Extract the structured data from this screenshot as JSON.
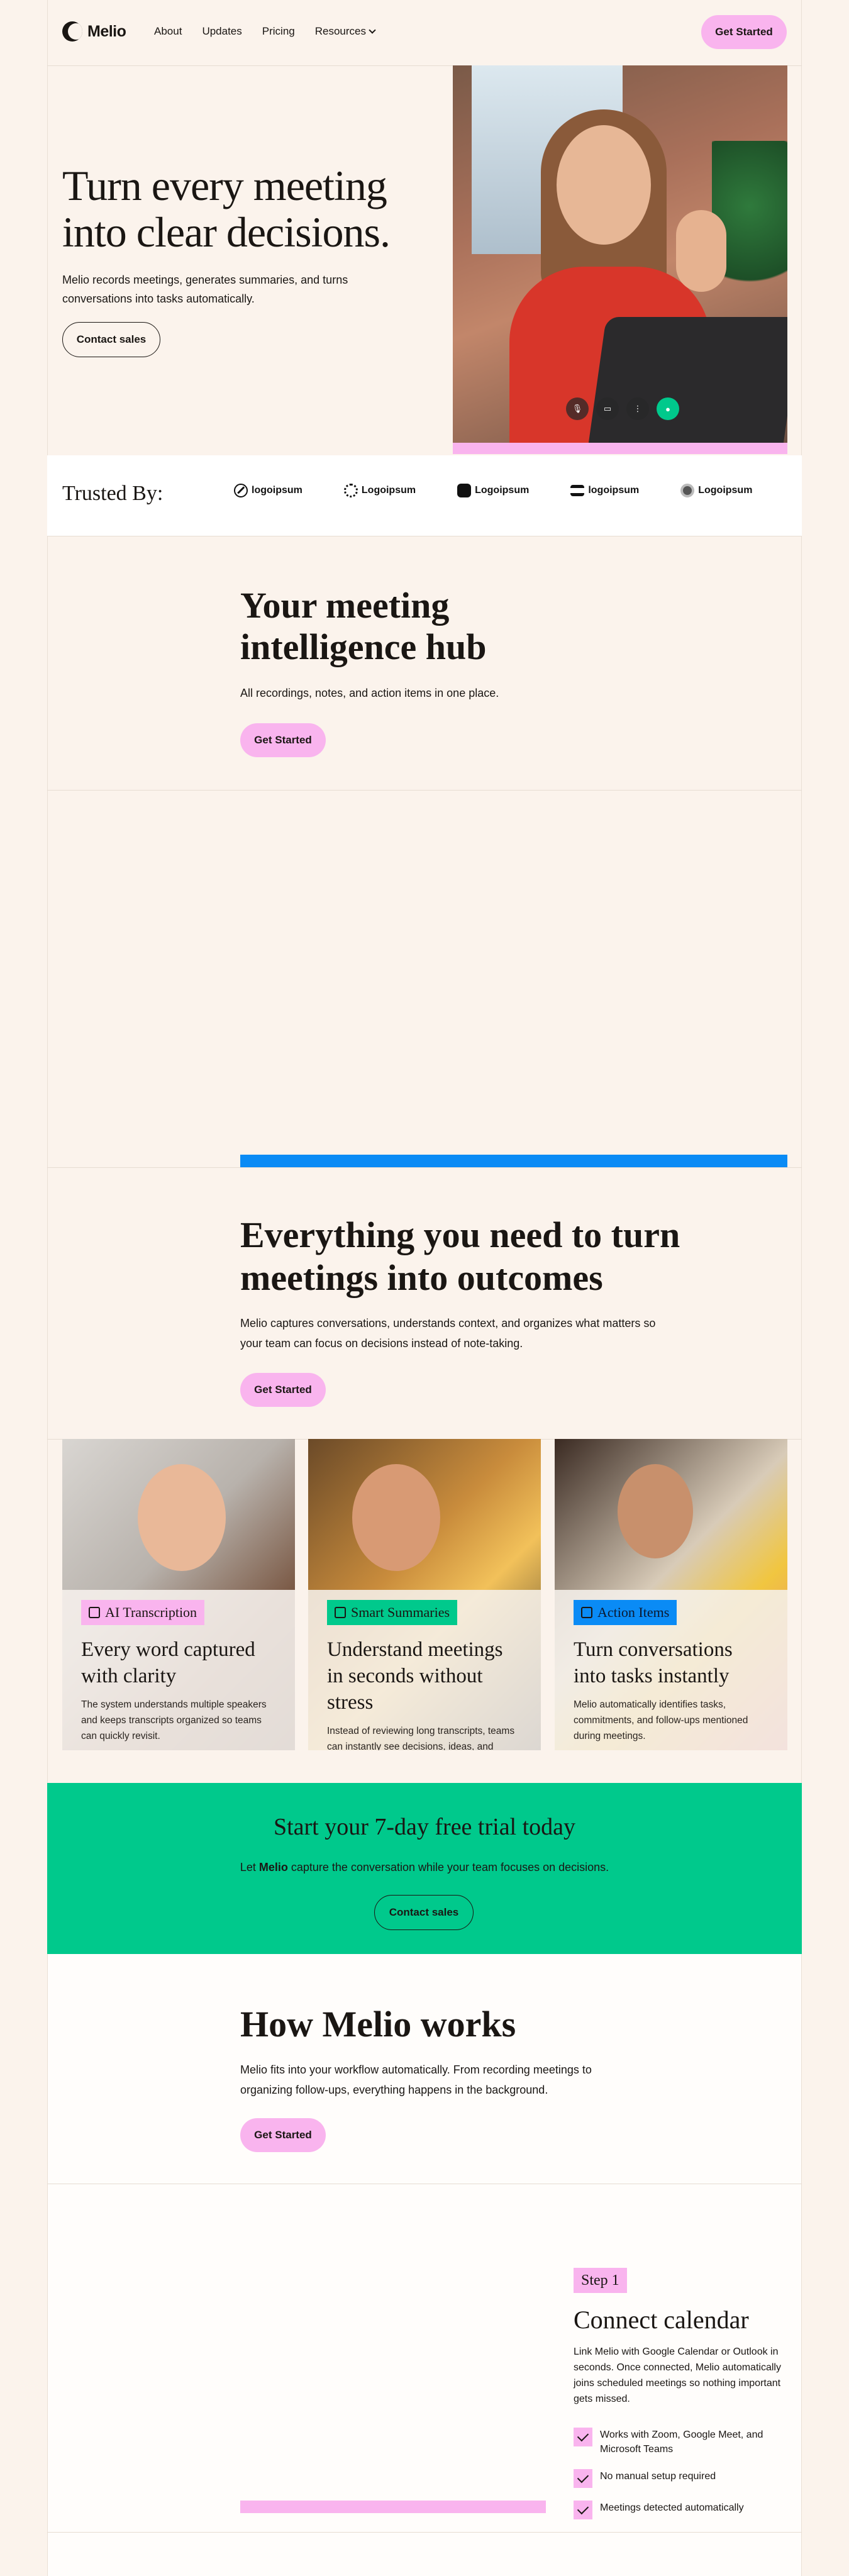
{
  "nav": {
    "brand": "Melio",
    "links": [
      "About",
      "Updates",
      "Pricing",
      "Resources"
    ],
    "cta": "Get Started"
  },
  "hero": {
    "title_line1": "Turn every meeting",
    "title_line2": "into clear decisions.",
    "subtitle_line1": "Melio records meetings, generates summaries, and turns",
    "subtitle_line2": "conversations into tasks automatically.",
    "cta": "Contact sales"
  },
  "trusted": {
    "label": "Trusted By:",
    "logos": [
      "logoipsum",
      "Logoipsum",
      "Logoipsum",
      "logoipsum",
      "Logoipsum"
    ]
  },
  "hub": {
    "title_line1": "Your meeting",
    "title_line2": "intelligence hub",
    "subtitle": "All recordings, notes, and action items in one place.",
    "cta": "Get Started"
  },
  "everything": {
    "title_line1": "Everything you need to turn",
    "title_line2": "meetings into outcomes",
    "subtitle_line1": "Melio captures conversations, understands context, and organizes what matters so",
    "subtitle_line2": "your team can focus on decisions instead of note-taking.",
    "cta": "Get Started"
  },
  "cards": [
    {
      "tag": "AI Transcription",
      "title": "Every word captured with clarity",
      "desc": "The system understands multiple speakers and keeps transcripts organized so teams can quickly revisit."
    },
    {
      "tag": "Smart Summaries",
      "title": "Understand meetings in seconds without stress",
      "desc": "Instead of reviewing long transcripts, teams can instantly see decisions, ideas, and important discussion topics."
    },
    {
      "tag": "Action Items",
      "title": "Turn conversations into tasks instantly",
      "desc": "Melio automatically identifies tasks, commitments, and follow-ups mentioned during meetings."
    }
  ],
  "trial": {
    "title": "Start your 7-day free trial today",
    "sub_pre": "Let ",
    "sub_brand": "Melio",
    "sub_post": " capture the conversation while your team focuses on decisions.",
    "cta": "Contact sales"
  },
  "how": {
    "title": "How Melio works",
    "subtitle_line1": "Melio fits into your workflow automatically. From recording meetings to",
    "subtitle_line2": "organizing follow-ups, everything happens in the background.",
    "cta": "Get Started"
  },
  "step": {
    "tag": "Step 1",
    "title": "Connect calendar",
    "desc": "Link Melio with Google Calendar or Outlook in seconds. Once connected, Melio automatically joins scheduled meetings so nothing important gets missed.",
    "checks": [
      "Works with Zoom, Google Meet, and Microsoft Teams",
      "No manual setup required",
      "Meetings detected automatically"
    ]
  },
  "colors": {
    "background": "#fbf3ec",
    "pink": "#f9b4ee",
    "green": "#00c98c",
    "blue": "#0a8bf5",
    "ink": "#1a1613"
  }
}
